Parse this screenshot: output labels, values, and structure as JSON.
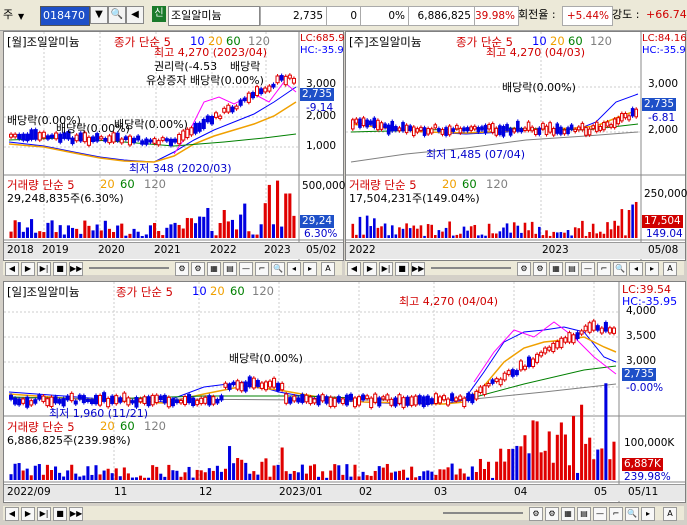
{
  "toolbar": {
    "label_left": "주",
    "code": "018470",
    "sin_badge": "신",
    "name": "조일알미늄",
    "price": "2,735",
    "change": "0",
    "pct": "0%",
    "volume": "6,886,825",
    "vol_ratio": "39.98%",
    "turnover_label": "회전율 :",
    "turnover": "+5.44%",
    "strength_label": "강도 :",
    "strength": "+66.74%"
  },
  "monthly": {
    "title": "[월]조일알미늄",
    "ma": [
      "종가 단순 5",
      "10",
      "20",
      "60",
      "120"
    ],
    "lc": "LC:685.9",
    "hc": "HC:-35.9",
    "price_tag": "2,735",
    "pct_tag": "-9.14",
    "axis": [
      "3,000",
      "2,000",
      "1,000"
    ],
    "high": "최고 4,270 (2023/04)",
    "low": "최저 348 (2020/03)",
    "ann": [
      "권리락(-4.53",
      "배당락",
      "유상증자 배당락(0.00%)",
      "배당락(0.00%)",
      "배당락(0.00%)",
      "배당락(0.00%)"
    ],
    "vol_title": "거래량 단순 5",
    "vol_ma": [
      "20",
      "60",
      "120"
    ],
    "vol_value": "29,248,835주(6.30%)",
    "vol_axis": "500,000",
    "vol_tag": "29,24",
    "vol_pct": "6.30%",
    "x": [
      "2018",
      "2019",
      "2020",
      "2021",
      "2022",
      "2023",
      "05/02"
    ]
  },
  "weekly": {
    "title": "[주]조일알미늄",
    "ma": [
      "종가 단순 5",
      "10",
      "20",
      "60",
      "120"
    ],
    "lc": "LC:84.16",
    "hc": "HC:-35.9",
    "price_tag": "2,735",
    "pct_tag": "-6.81",
    "axis": [
      "3,000",
      "2,000"
    ],
    "high": "최고 4,270 (04/03)",
    "low": "최저 1,485 (07/04)",
    "ann": "배당락(0.00%)",
    "vol_title": "거래량 단순 5",
    "vol_ma": [
      "20",
      "60",
      "120"
    ],
    "vol_value": "17,504,231주(149.04%)",
    "vol_axis": "250,000",
    "vol_tag": "17,504",
    "vol_pct": "149.04",
    "x": [
      "2022",
      "2023",
      "05/08"
    ]
  },
  "daily": {
    "title": "[일]조일알미늄",
    "ma": [
      "종가 단순 5",
      "10",
      "20",
      "60",
      "120"
    ],
    "lc": "LC:39.54",
    "hc": "HC:-35.95",
    "price_tag": "2,735",
    "pct_tag": "-0.00%",
    "axis": [
      "4,000",
      "3,500",
      "3,000"
    ],
    "high": "최고 4,270 (04/04)",
    "low": "최저 1,960 (11/21)",
    "ann": "배당락(0.00%)",
    "vol_title": "거래량 단순 5",
    "vol_ma": [
      "20",
      "60",
      "120"
    ],
    "vol_value": "6,886,825주(239.98%)",
    "vol_axis": "100,000K",
    "vol_tag": "6,887K",
    "vol_pct": "239.98%",
    "x": [
      "2022/09",
      "11",
      "12",
      "2023/01",
      "02",
      "03",
      "04",
      "05",
      "05/11"
    ]
  },
  "colors": {
    "ma5": "#ff00ff",
    "ma10": "#0000ff",
    "ma20": "#f0a000",
    "ma60": "#008000",
    "ma120": "#808080",
    "up": "#e00000",
    "down": "#0000e0"
  }
}
